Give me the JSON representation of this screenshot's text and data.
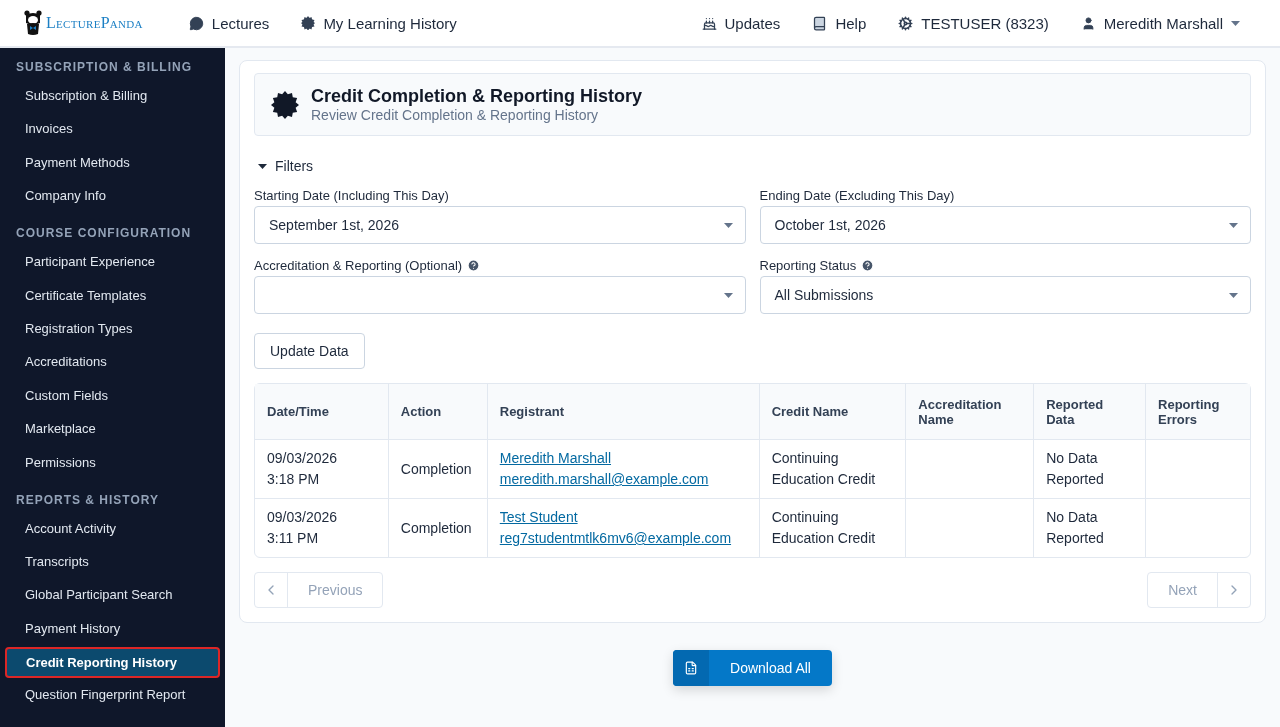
{
  "topbar": {
    "logo": "LecturePanda",
    "nav": [
      {
        "kind": "lectures",
        "label": "Lectures"
      },
      {
        "kind": "history",
        "label": "My Learning History"
      }
    ],
    "right": [
      {
        "kind": "updates",
        "label": "Updates"
      },
      {
        "kind": "help",
        "label": "Help"
      },
      {
        "kind": "account",
        "label": "TESTUSER (8323)"
      },
      {
        "kind": "user",
        "label": "Meredith Marshall"
      }
    ]
  },
  "sidebar": {
    "sections": [
      {
        "title": "SUBSCRIPTION & BILLING",
        "items": [
          {
            "label": "Subscription & Billing",
            "selected": false
          },
          {
            "label": "Invoices",
            "selected": false
          },
          {
            "label": "Payment Methods",
            "selected": false
          },
          {
            "label": "Company Info",
            "selected": false
          }
        ]
      },
      {
        "title": "COURSE CONFIGURATION",
        "items": [
          {
            "label": "Participant Experience",
            "selected": false
          },
          {
            "label": "Certificate Templates",
            "selected": false
          },
          {
            "label": "Registration Types",
            "selected": false
          },
          {
            "label": "Accreditations",
            "selected": false
          },
          {
            "label": "Custom Fields",
            "selected": false
          },
          {
            "label": "Marketplace",
            "selected": false
          },
          {
            "label": "Permissions",
            "selected": false
          }
        ]
      },
      {
        "title": "REPORTS & HISTORY",
        "items": [
          {
            "label": "Account Activity",
            "selected": false
          },
          {
            "label": "Transcripts",
            "selected": false
          },
          {
            "label": "Global Participant Search",
            "selected": false
          },
          {
            "label": "Payment History",
            "selected": false
          },
          {
            "label": "Credit Reporting History",
            "selected": true
          },
          {
            "label": "Question Fingerprint Report",
            "selected": false
          }
        ]
      }
    ]
  },
  "header": {
    "title": "Credit Completion & Reporting History",
    "subtitle": "Review Credit Completion & Reporting History"
  },
  "filters": {
    "label": "Filters",
    "expanded": true,
    "fields": [
      {
        "label": "Starting Date (Including This Day)",
        "value": "September 1st, 2026",
        "help": false
      },
      {
        "label": "Ending Date (Excluding This Day)",
        "value": "October 1st, 2026",
        "help": false
      },
      {
        "label": "Accreditation & Reporting (Optional)",
        "help": true
      },
      {
        "label": "Reporting Status",
        "value": "All Submissions",
        "help": true
      }
    ],
    "button": "Update Data"
  },
  "table": {
    "columns": [
      "Date/Time",
      "Action",
      "Registrant",
      "Credit Name",
      "Accreditation Name",
      "Reported Data",
      "Reporting Errors"
    ],
    "rows": [
      {
        "date": "09/03/2026",
        "time": "3:18 PM",
        "action": "Completion",
        "name": "Meredith Marshall",
        "email": "meredith.marshall@example.com",
        "credit": "Continuing Education Credit",
        "reported": "No Data Reported"
      },
      {
        "date": "09/03/2026",
        "time": "3:11 PM",
        "action": "Completion",
        "name": "Test Student",
        "email": "reg7studentmtlk6mv6@example.com",
        "credit": "Continuing Education Credit",
        "reported": "No Data Reported"
      }
    ]
  },
  "pager": {
    "previous": "Previous",
    "next": "Next",
    "disabled": true
  },
  "download": "Download All"
}
